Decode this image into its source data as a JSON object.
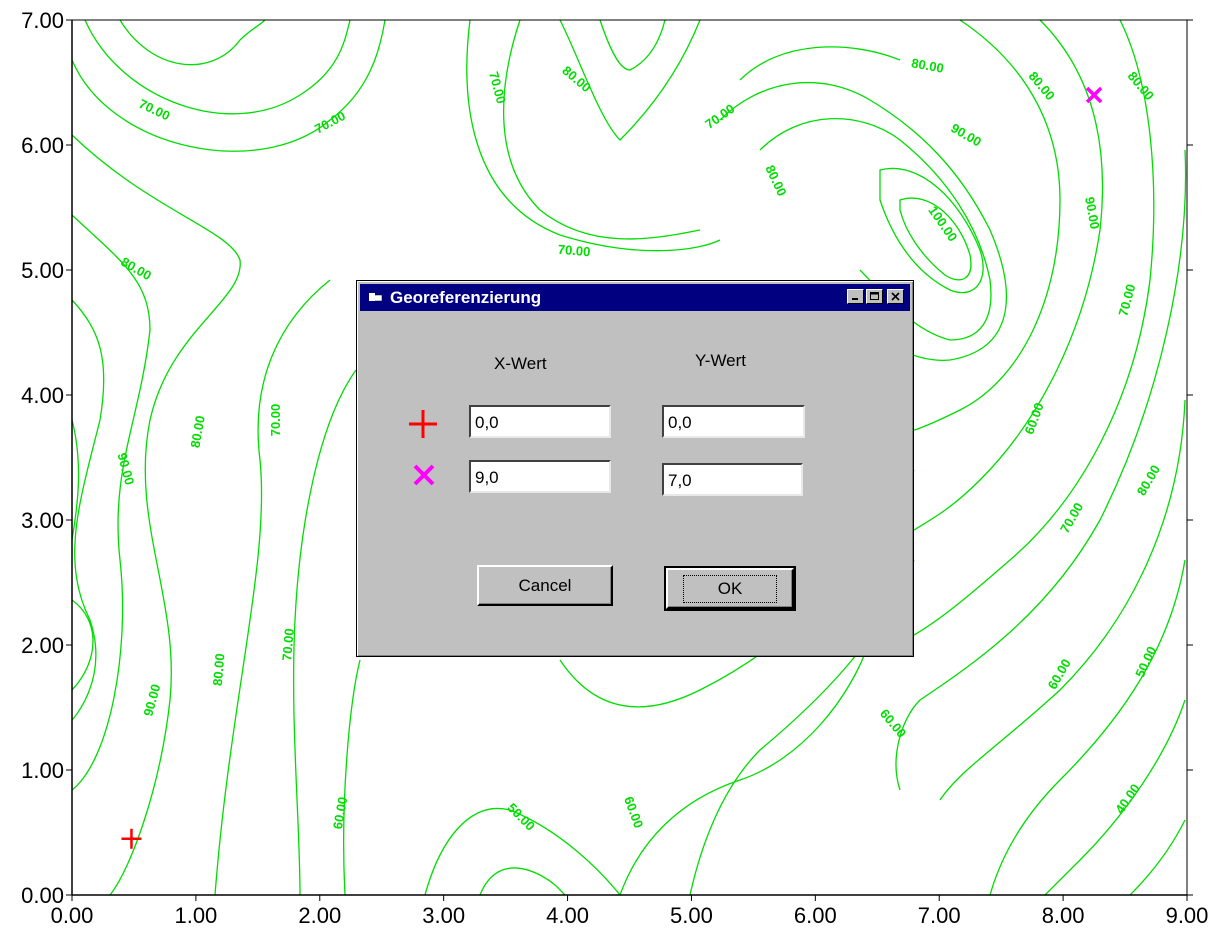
{
  "chart_data": {
    "type": "contour",
    "xlim": [
      0,
      9
    ],
    "ylim": [
      0,
      7
    ],
    "x_ticks": [
      "0.00",
      "1.00",
      "2.00",
      "3.00",
      "4.00",
      "5.00",
      "6.00",
      "7.00",
      "8.00",
      "9.00"
    ],
    "y_ticks": [
      "0.00",
      "1.00",
      "2.00",
      "3.00",
      "4.00",
      "5.00",
      "6.00",
      "7.00"
    ],
    "contour_labels": [
      {
        "text": "70.00",
        "x": 0.65,
        "y": 6.25,
        "rotation": 25
      },
      {
        "text": "70.00",
        "x": 2.1,
        "y": 6.15,
        "rotation": -28
      },
      {
        "text": "70.00",
        "x": 3.4,
        "y": 6.45,
        "rotation": 75
      },
      {
        "text": "80.00",
        "x": 4.05,
        "y": 6.5,
        "rotation": 40
      },
      {
        "text": "70.00",
        "x": 5.25,
        "y": 6.2,
        "rotation": -35
      },
      {
        "text": "80.00",
        "x": 6.9,
        "y": 6.6,
        "rotation": 10
      },
      {
        "text": "80.00",
        "x": 7.8,
        "y": 6.45,
        "rotation": 50
      },
      {
        "text": "80.00",
        "x": 8.6,
        "y": 6.45,
        "rotation": 50
      },
      {
        "text": "90.00",
        "x": 7.2,
        "y": 6.05,
        "rotation": 30
      },
      {
        "text": "80.00",
        "x": 5.65,
        "y": 5.7,
        "rotation": 65
      },
      {
        "text": "100.00",
        "x": 7.0,
        "y": 5.35,
        "rotation": 55
      },
      {
        "text": "90.00",
        "x": 8.2,
        "y": 5.45,
        "rotation": 80
      },
      {
        "text": "70.00",
        "x": 4.05,
        "y": 5.12,
        "rotation": 5
      },
      {
        "text": "80.00",
        "x": 0.5,
        "y": 4.98,
        "rotation": 30
      },
      {
        "text": "70.00",
        "x": 8.55,
        "y": 4.75,
        "rotation": -75
      },
      {
        "text": "90.00",
        "x": 0.4,
        "y": 3.4,
        "rotation": 75
      },
      {
        "text": "80.00",
        "x": 1.05,
        "y": 3.7,
        "rotation": -80
      },
      {
        "text": "70.00",
        "x": 1.68,
        "y": 3.8,
        "rotation": -90
      },
      {
        "text": "60.00",
        "x": 7.8,
        "y": 3.8,
        "rotation": -70
      },
      {
        "text": "80.00",
        "x": 8.72,
        "y": 3.3,
        "rotation": -60
      },
      {
        "text": "70.00",
        "x": 8.1,
        "y": 3.0,
        "rotation": -60
      },
      {
        "text": "90.00",
        "x": 0.68,
        "y": 1.55,
        "rotation": -75
      },
      {
        "text": "80.00",
        "x": 1.22,
        "y": 1.8,
        "rotation": -85
      },
      {
        "text": "70.00",
        "x": 1.78,
        "y": 2.0,
        "rotation": -85
      },
      {
        "text": "60.00",
        "x": 8.0,
        "y": 1.75,
        "rotation": -60
      },
      {
        "text": "50.00",
        "x": 8.7,
        "y": 1.85,
        "rotation": -65
      },
      {
        "text": "60.00",
        "x": 6.6,
        "y": 1.35,
        "rotation": 50
      },
      {
        "text": "60.00",
        "x": 2.2,
        "y": 0.65,
        "rotation": -80
      },
      {
        "text": "50.00",
        "x": 3.6,
        "y": 0.6,
        "rotation": 45
      },
      {
        "text": "60.00",
        "x": 4.5,
        "y": 0.65,
        "rotation": 70
      },
      {
        "text": "40.00",
        "x": 8.55,
        "y": 0.75,
        "rotation": -55
      }
    ],
    "markers": [
      {
        "name": "plus",
        "x": 0.48,
        "y": 0.45,
        "color": "#ff0000"
      },
      {
        "name": "cross",
        "x": 8.25,
        "y": 6.4,
        "color": "#ff00ff"
      }
    ]
  },
  "dialog": {
    "title": "Georeferenzierung",
    "x_header": "X-Wert",
    "y_header": "Y-Wert",
    "row1": {
      "marker": "plus-marker-icon",
      "marker_color": "#ff0000",
      "x_value": "0,0",
      "y_value": "0,0"
    },
    "row2": {
      "marker": "cross-marker-icon",
      "marker_color": "#ff00ff",
      "x_value": "9,0",
      "y_value": "7,0"
    },
    "cancel_label": "Cancel",
    "ok_label": "OK"
  },
  "colors": {
    "contour": "#00dd00",
    "titlebar": "#000080",
    "dialog_bg": "#c0c0c0"
  }
}
